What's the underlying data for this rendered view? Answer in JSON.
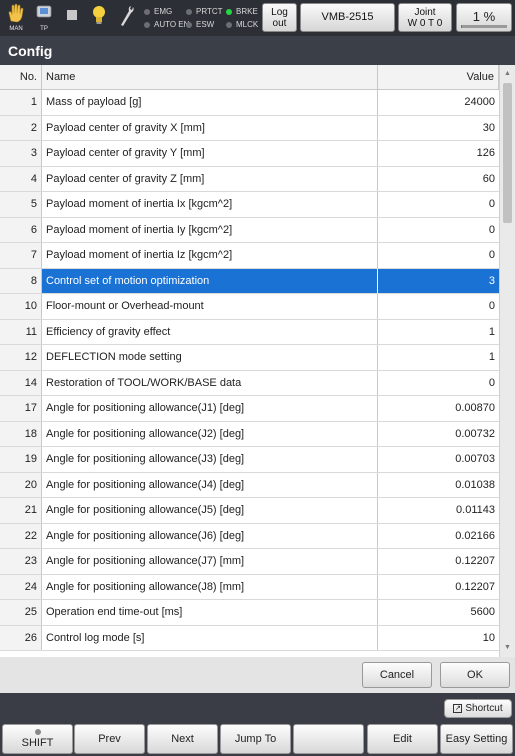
{
  "status_bar": {
    "mode_label": "MAN",
    "tp_label": "TP",
    "lamps_left": [
      {
        "label": "EMG",
        "on": false
      },
      {
        "label": "AUTO EN",
        "on": false
      }
    ],
    "lamps_mid": [
      {
        "label": "PRTCT",
        "on": false
      },
      {
        "label": "ESW",
        "on": false
      }
    ],
    "lamps_right": [
      {
        "label": "BRKE",
        "on": true
      },
      {
        "label": "MLCK",
        "on": false
      }
    ],
    "logout_label": "Log out",
    "robot_model": "VMB-2515",
    "coord_label": "Joint",
    "coord_sub": "W 0 T 0",
    "speed_text": "1 %",
    "speed_fraction": 0.01
  },
  "page": {
    "title": "Config"
  },
  "table": {
    "headers": {
      "no": "No.",
      "name": "Name",
      "value": "Value"
    },
    "rows": [
      {
        "no": "1",
        "name": "Mass of payload [g]",
        "value": "24000"
      },
      {
        "no": "2",
        "name": "Payload center of gravity X [mm]",
        "value": "30"
      },
      {
        "no": "3",
        "name": "Payload center of gravity Y [mm]",
        "value": "126"
      },
      {
        "no": "4",
        "name": "Payload center of gravity Z [mm]",
        "value": "60"
      },
      {
        "no": "5",
        "name": "Payload moment of inertia Ix [kgcm^2]",
        "value": "0"
      },
      {
        "no": "6",
        "name": "Payload moment of inertia Iy [kgcm^2]",
        "value": "0"
      },
      {
        "no": "7",
        "name": "Payload moment of inertia Iz [kgcm^2]",
        "value": "0"
      },
      {
        "no": "8",
        "name": "Control set of motion optimization",
        "value": "3",
        "selected": true
      },
      {
        "no": "10",
        "name": "Floor-mount or Overhead-mount",
        "value": "0"
      },
      {
        "no": "11",
        "name": "Efficiency of gravity effect",
        "value": "1"
      },
      {
        "no": "12",
        "name": "DEFLECTION mode setting",
        "value": "1"
      },
      {
        "no": "14",
        "name": "Restoration of TOOL/WORK/BASE data",
        "value": "0"
      },
      {
        "no": "17",
        "name": "Angle for positioning allowance(J1) [deg]",
        "value": "0.00870"
      },
      {
        "no": "18",
        "name": "Angle for positioning allowance(J2) [deg]",
        "value": "0.00732"
      },
      {
        "no": "19",
        "name": "Angle for positioning allowance(J3) [deg]",
        "value": "0.00703"
      },
      {
        "no": "20",
        "name": "Angle for positioning allowance(J4) [deg]",
        "value": "0.01038"
      },
      {
        "no": "21",
        "name": "Angle for positioning allowance(J5) [deg]",
        "value": "0.01143"
      },
      {
        "no": "22",
        "name": "Angle for positioning allowance(J6) [deg]",
        "value": "0.02166"
      },
      {
        "no": "23",
        "name": "Angle for positioning allowance(J7) [mm]",
        "value": "0.12207"
      },
      {
        "no": "24",
        "name": "Angle for positioning allowance(J8) [mm]",
        "value": "0.12207"
      },
      {
        "no": "25",
        "name": "Operation end time-out  [ms]",
        "value": "5600"
      },
      {
        "no": "26",
        "name": "Control log mode [s]",
        "value": "10"
      }
    ]
  },
  "dialog": {
    "cancel_label": "Cancel",
    "ok_label": "OK"
  },
  "bottom_bar": {
    "shortcut_label": "Shortcut",
    "buttons": [
      {
        "label": "SHIFT"
      },
      {
        "label": "Prev"
      },
      {
        "label": "Next"
      },
      {
        "label": "Jump To"
      },
      {
        "label": ""
      },
      {
        "label": "Edit"
      },
      {
        "label": "Easy Setting"
      }
    ]
  },
  "colors": {
    "selection": "#1a72d4",
    "lamp_on": "#27d640",
    "titlebar": "#3b3f48"
  }
}
